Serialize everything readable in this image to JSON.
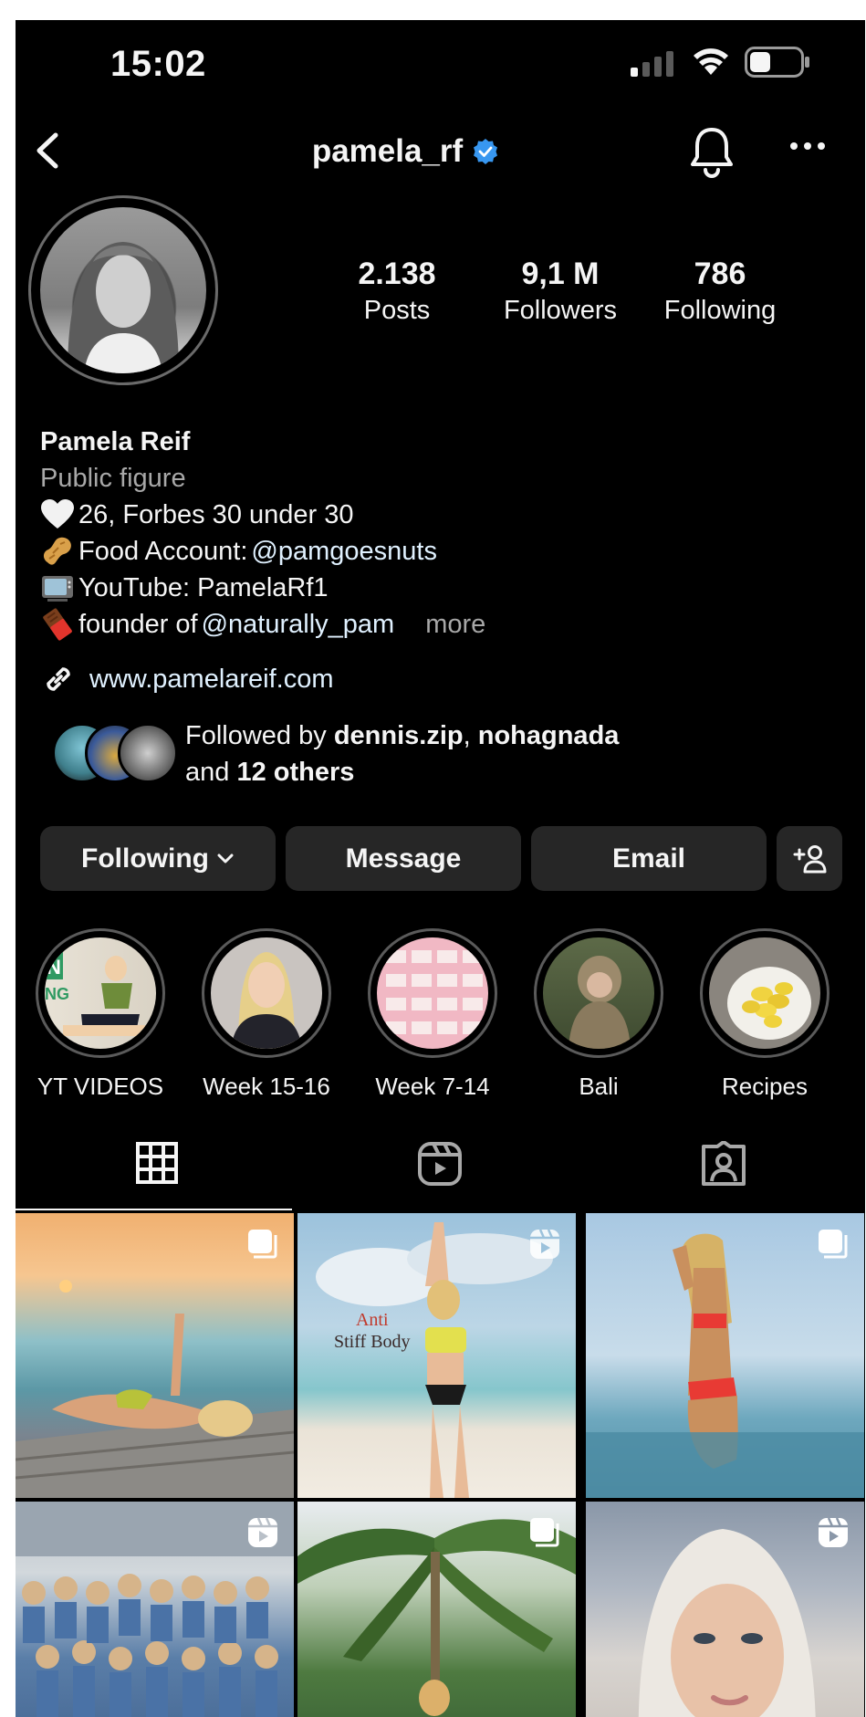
{
  "status_bar": {
    "time": "15:02"
  },
  "nav": {
    "username": "pamela_rf"
  },
  "stats": [
    {
      "value": "2.138",
      "label": "Posts"
    },
    {
      "value": "9,1 M",
      "label": "Followers"
    },
    {
      "value": "786",
      "label": "Following"
    }
  ],
  "bio": {
    "name": "Pamela Reif",
    "category": "Public figure",
    "line1": "26, Forbes 30 under 30",
    "line2_prefix": "Food Account: ",
    "line2_link": "@pamgoesnuts",
    "line3": "YouTube: PamelaRf1",
    "line4_prefix": " founder of ",
    "line4_link": "@naturally_pam",
    "more": "more",
    "website": "www.pamelareif.com"
  },
  "followed_by": {
    "prefix": "Followed by ",
    "user1": "dennis.zip",
    "sep": ", ",
    "user2": "nohagnada",
    "line2_prefix": "and ",
    "others": "12 others"
  },
  "buttons": {
    "following": "Following",
    "message": "Message",
    "email": "Email"
  },
  "highlights": [
    {
      "label": "YT VIDEOS"
    },
    {
      "label": "Week 15-16"
    },
    {
      "label": "Week 7-14"
    },
    {
      "label": "Bali"
    },
    {
      "label": "Recipes"
    }
  ],
  "posts": {
    "post1_caption_line1": "Anti",
    "post1_caption_line2": "Stiff Body"
  },
  "hl_thumb_text": {
    "a": "N",
    "b": "NG"
  },
  "colors": {
    "background": "#000000",
    "button": "#262626",
    "verified": "#3897f0",
    "link": "#e0f1ff",
    "muted": "#a8a8a8"
  },
  "icons": [
    "back-icon",
    "verified-icon",
    "bell-icon",
    "more-icon",
    "chevron-down-icon",
    "add-person-icon",
    "link-icon",
    "grid-icon",
    "reels-icon",
    "tagged-icon",
    "carousel-icon",
    "reel-icon"
  ]
}
